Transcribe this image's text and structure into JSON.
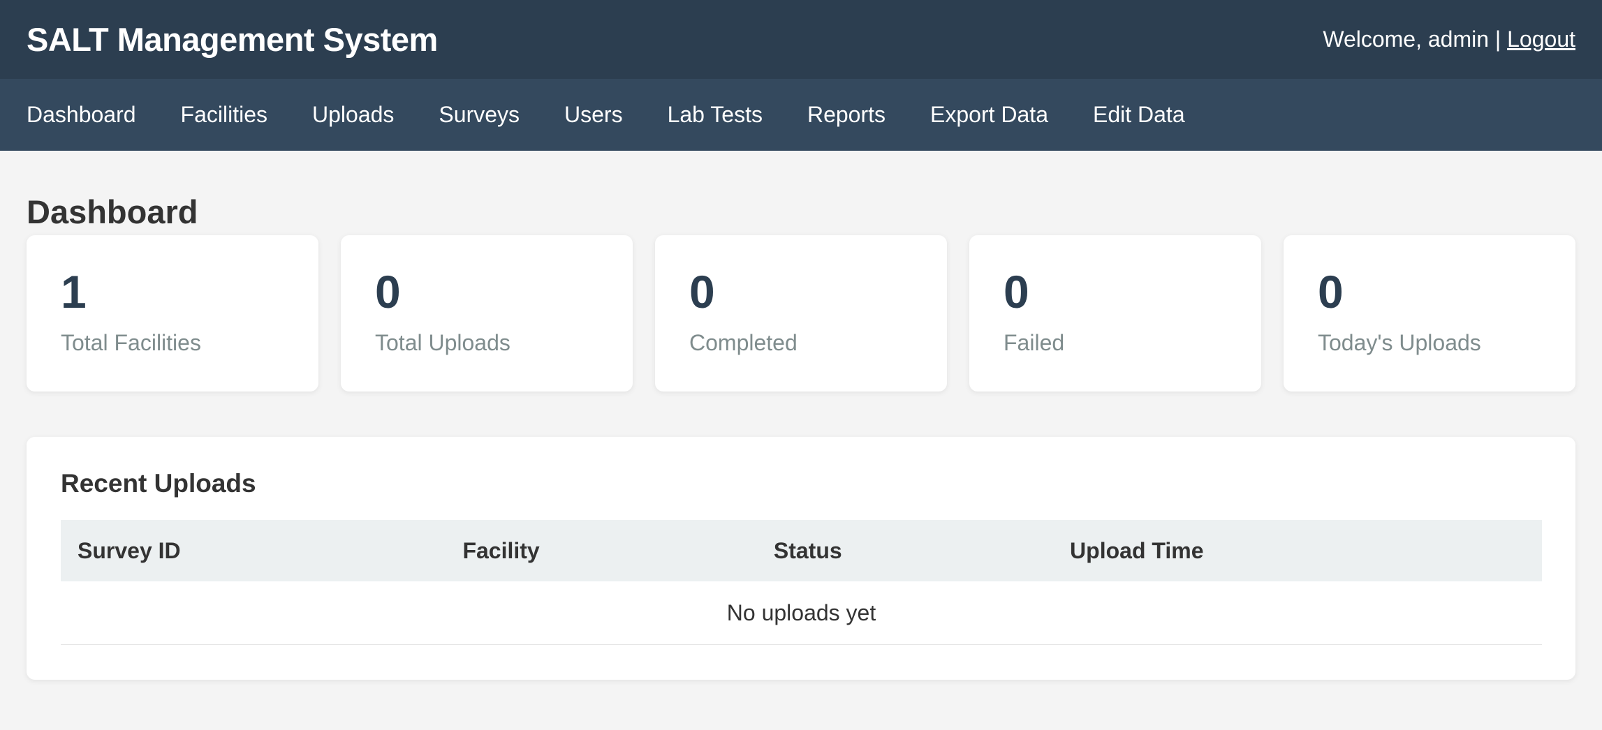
{
  "header": {
    "app_title": "SALT Management System",
    "welcome_text": "Welcome, admin |",
    "logout_label": "Logout"
  },
  "nav": {
    "items": [
      {
        "label": "Dashboard"
      },
      {
        "label": "Facilities"
      },
      {
        "label": "Uploads"
      },
      {
        "label": "Surveys"
      },
      {
        "label": "Users"
      },
      {
        "label": "Lab Tests"
      },
      {
        "label": "Reports"
      },
      {
        "label": "Export Data"
      },
      {
        "label": "Edit Data"
      }
    ]
  },
  "page": {
    "title": "Dashboard"
  },
  "stats": [
    {
      "value": "1",
      "label": "Total Facilities"
    },
    {
      "value": "0",
      "label": "Total Uploads"
    },
    {
      "value": "0",
      "label": "Completed"
    },
    {
      "value": "0",
      "label": "Failed"
    },
    {
      "value": "0",
      "label": "Today's Uploads"
    }
  ],
  "recent_uploads": {
    "title": "Recent Uploads",
    "columns": [
      "Survey ID",
      "Facility",
      "Status",
      "Upload Time"
    ],
    "empty_message": "No uploads yet"
  },
  "colors": {
    "topbar": "#2c3e50",
    "navbar": "#34495e",
    "background": "#f4f4f4",
    "stat_value": "#2c3e50",
    "stat_label": "#7f8c8d",
    "table_header": "#ecf0f1"
  }
}
